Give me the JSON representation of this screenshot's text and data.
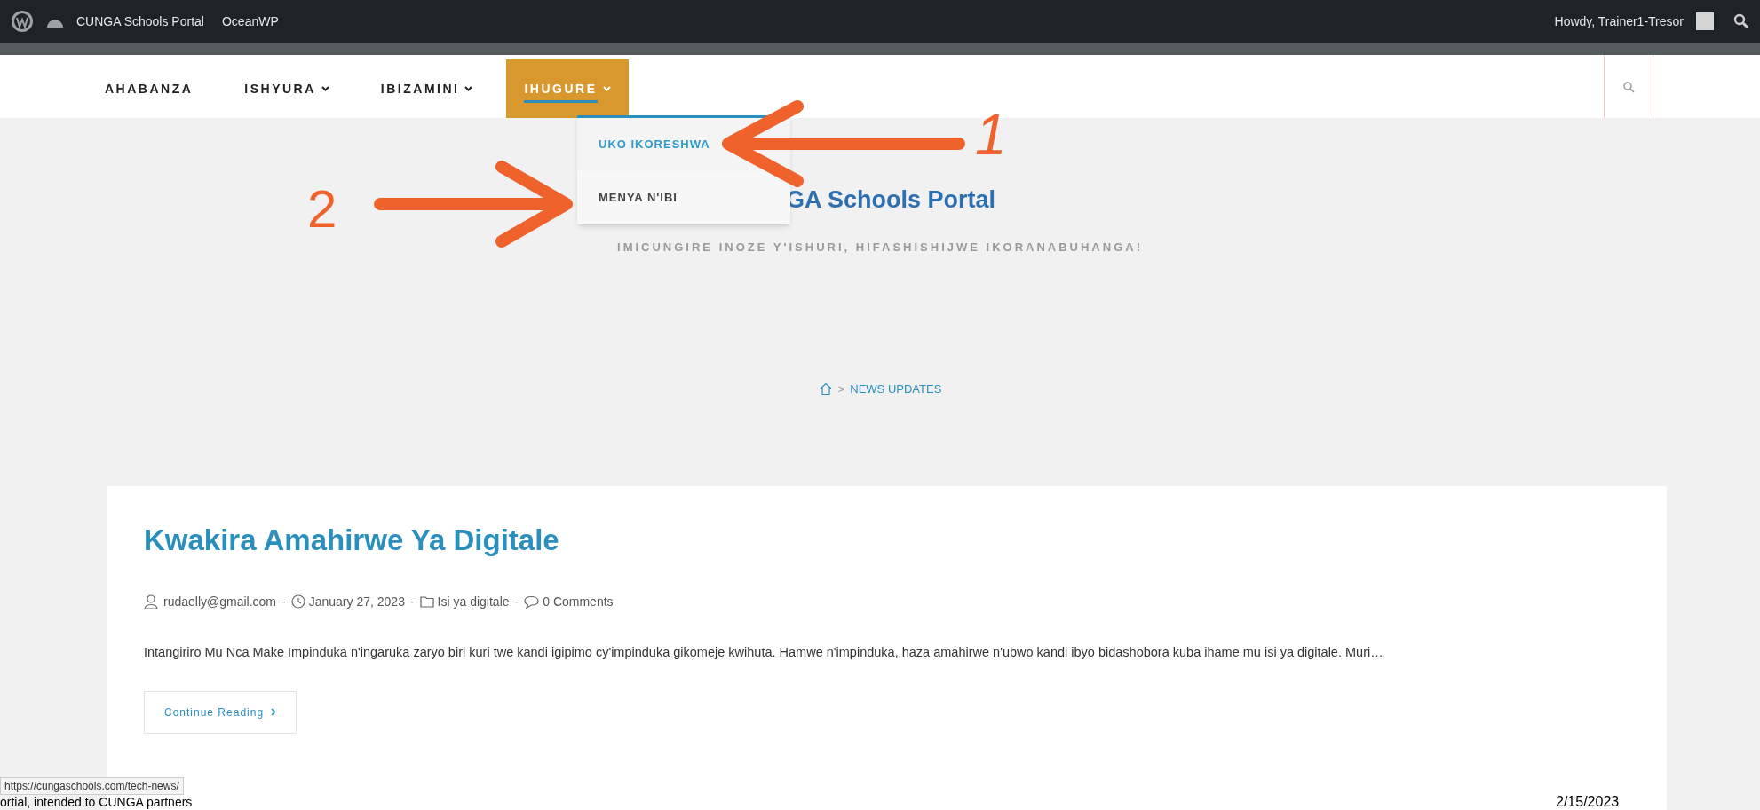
{
  "admin_bar": {
    "site_name": "CUNGA Schools Portal",
    "theme": "OceanWP",
    "greeting": "Howdy, Trainer1-Tresor"
  },
  "nav": {
    "items": [
      {
        "label": "AHABANZA",
        "has_dropdown": false,
        "selected": false
      },
      {
        "label": "ISHYURA",
        "has_dropdown": true,
        "selected": false
      },
      {
        "label": "IBIZAMINI",
        "has_dropdown": true,
        "selected": false
      },
      {
        "label": "IHUGURE",
        "has_dropdown": true,
        "selected": true
      }
    ],
    "dropdown": [
      {
        "label": "UKO IKORESHWA",
        "selected": true
      },
      {
        "label": "MENYA N'IBI",
        "selected": false
      }
    ]
  },
  "header": {
    "site_title": "GA Schools Portal",
    "tagline": "IMICUNGIRE INOZE Y'ISHURI, HIFASHISHIJWE IKORANABUHANGA!"
  },
  "breadcrumb": {
    "separator": ">",
    "current": "NEWS UPDATES"
  },
  "post": {
    "meta_separator": "-",
    "title": "Kwakira Amahirwe Ya Digitale",
    "author": "rudaelly@gmail.com",
    "date": "January 27, 2023",
    "category": "Isi ya digitale",
    "comments": "0 Comments",
    "excerpt": "Intangiriro Mu Nca Make Impinduka n'ingaruka zaryo biri kuri twe kandi igipimo cy'impinduka gikomeje kwihuta. Hamwe n'impinduka, haza amahirwe n'ubwo kandi ibyo bidashobora kuba ihame mu isi ya digitale. Muri…",
    "button": "Continue Reading"
  },
  "annotations": [
    {
      "label": "1"
    },
    {
      "label": "2"
    }
  ],
  "status_url": "https://cungaschools.com/tech-news/",
  "slide_footer": {
    "left": "ortial, intended to CUNGA partners",
    "right": "2/15/2023"
  }
}
